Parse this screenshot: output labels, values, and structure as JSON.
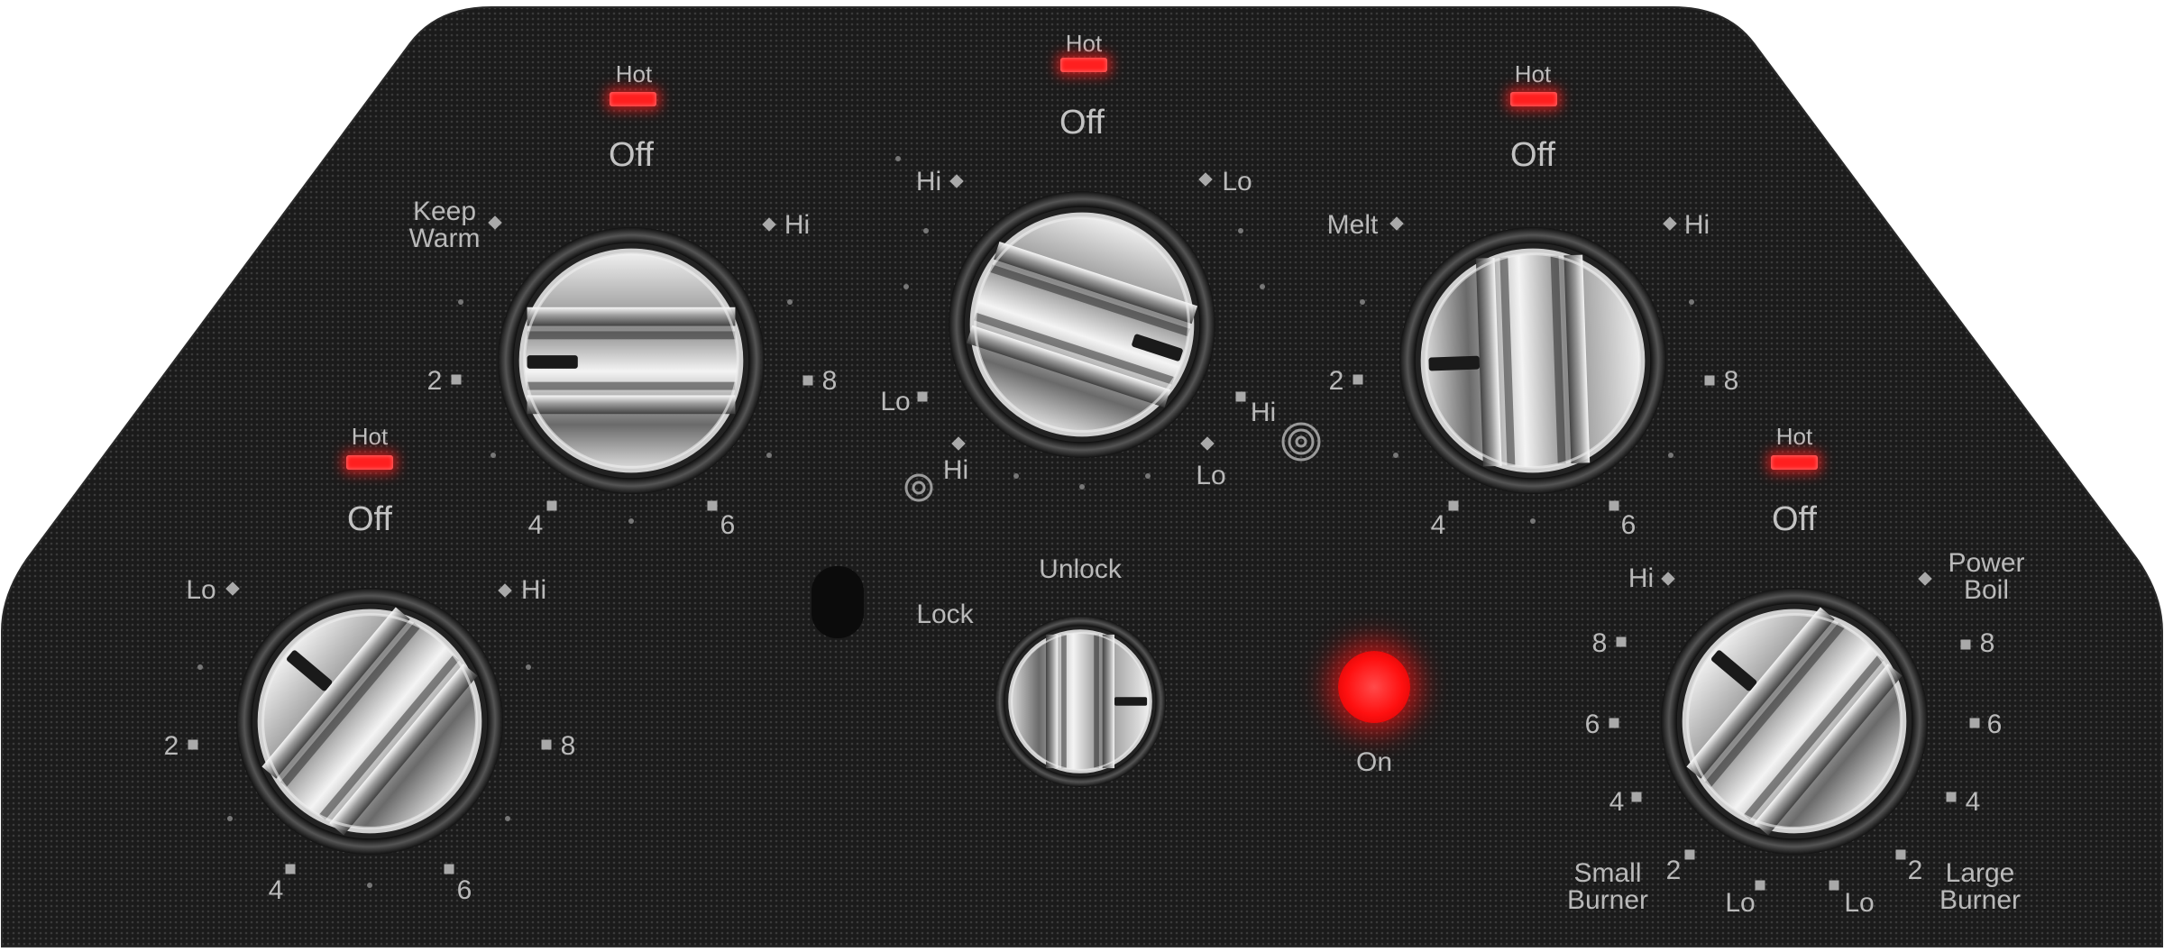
{
  "colors": {
    "panel": "#1c1c1c",
    "label": "#b9b9b9",
    "hot_indicator": "#ff1f1f",
    "on_indicator": "#ff1a1a",
    "knob_chrome": "#c8c8c8"
  },
  "icons": [
    "hot-indicator-icon",
    "bridge-element-icon",
    "dual-element-icon",
    "on-indicator-icon",
    "lock-sensor-icon"
  ],
  "knobs": {
    "left_rear": {
      "hot": "Hot",
      "off": "Off",
      "keep_warm": "Keep\nWarm",
      "hi": "Hi",
      "two": "2",
      "eight": "8",
      "four": "4",
      "six": "6"
    },
    "center_rear": {
      "hot": "Hot",
      "off": "Off",
      "hi_top": "Hi",
      "lo_top": "Lo",
      "lo_left": "Lo",
      "hi_right": "Hi",
      "hi_bottom": "Hi",
      "lo_bottom": "Lo"
    },
    "right_rear": {
      "hot": "Hot",
      "off": "Off",
      "melt": "Melt",
      "hi": "Hi",
      "two": "2",
      "eight": "8",
      "four": "4",
      "six": "6"
    },
    "left_front": {
      "hot": "Hot",
      "off": "Off",
      "lo": "Lo",
      "hi": "Hi",
      "two": "2",
      "eight": "8",
      "four": "4",
      "six": "6"
    },
    "right_front": {
      "hot": "Hot",
      "off": "Off",
      "hi": "Hi",
      "power_boil": "Power\nBoil",
      "eight_l": "8",
      "eight_r": "8",
      "six_l": "6",
      "six_r": "6",
      "four_l": "4",
      "four_r": "4",
      "two_l": "2",
      "two_r": "2",
      "lo_l": "Lo",
      "lo_r": "Lo",
      "small_burner": "Small\nBurner",
      "large_burner": "Large\nBurner"
    }
  },
  "lock": {
    "unlock": "Unlock",
    "lock": "Lock"
  },
  "power": {
    "on": "On"
  }
}
